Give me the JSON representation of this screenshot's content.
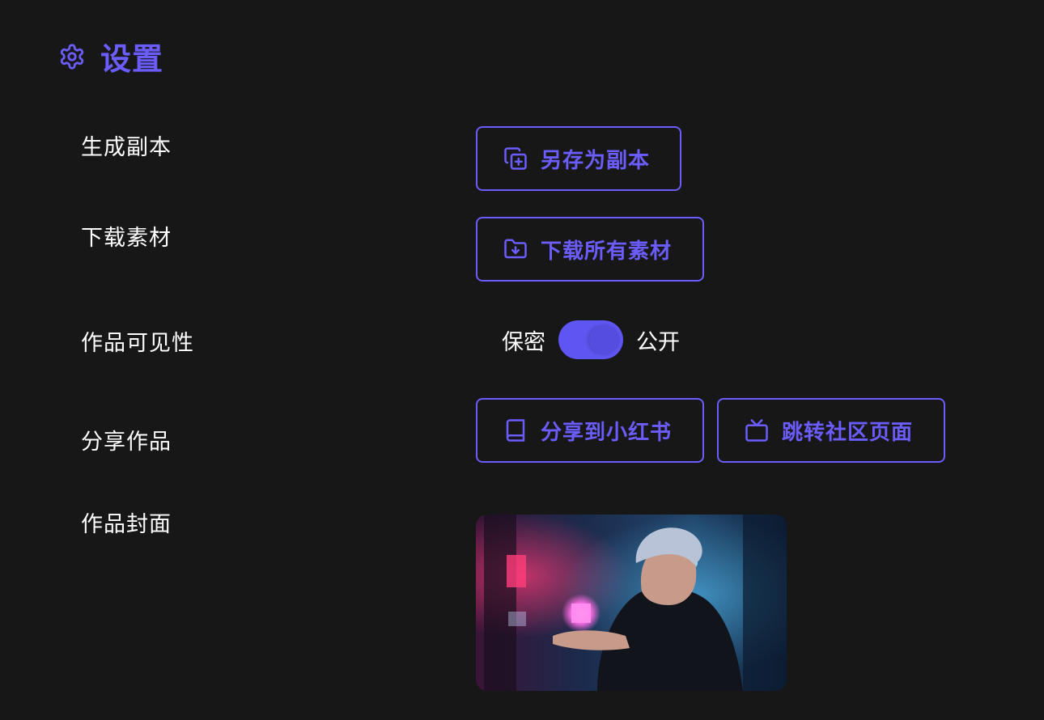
{
  "header": {
    "title": "设置",
    "icon": "gear-icon",
    "accent_color": "#6b5cff"
  },
  "rows": {
    "copy": {
      "label": "生成副本",
      "button_label": "另存为副本",
      "button_icon": "copy-plus-icon"
    },
    "download": {
      "label": "下载素材",
      "button_label": "下载所有素材",
      "button_icon": "folder-download-icon"
    },
    "visibility": {
      "label": "作品可见性",
      "off_label": "保密",
      "on_label": "公开",
      "enabled": true
    },
    "share": {
      "label": "分享作品",
      "xiaohongshu_label": "分享到小红书",
      "xiaohongshu_icon": "book-icon",
      "community_label": "跳转社区页面",
      "community_icon": "tv-icon"
    },
    "cover": {
      "label": "作品封面"
    }
  }
}
